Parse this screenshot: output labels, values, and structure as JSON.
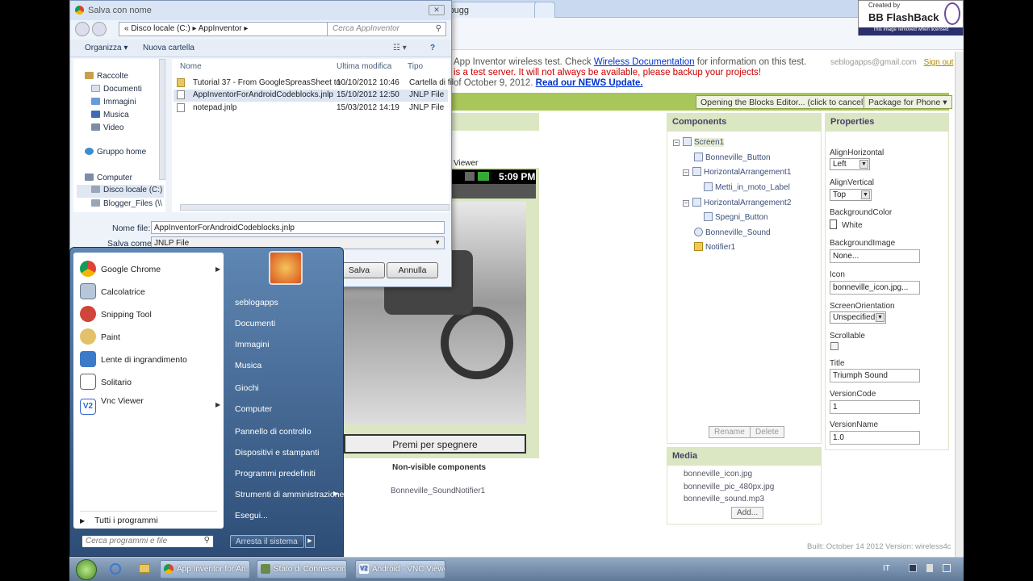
{
  "browser": {
    "tabs": [
      {
        "title": "App Inventor Debugg"
      },
      {
        "title": ""
      }
    ],
    "flashback": {
      "created_by": "Created by",
      "brand": "BB FlashBack",
      "notice": "This image removed when licensed"
    }
  },
  "appinventor": {
    "message_line1_pre": "App Inventor wireless test. Check ",
    "message_line1_link": "Wireless Documentation",
    "message_line1_post": " for information on this test.",
    "message_line2": "is a test server. It will not always be available, please backup your projects!",
    "message_line3_pre": "of October 9, 2012. ",
    "message_line3_link": "Read our NEWS Update.",
    "user_email": "seblogapps@gmail.com",
    "sign_out": "Sign out",
    "blocks_button": "Opening the Blocks Editor... (click to cancel)",
    "package_button": "Package for Phone ▾",
    "components_title": "Components",
    "properties_title": "Properties",
    "components": [
      {
        "label": "Screen1",
        "expand": "⊟"
      },
      {
        "label": "Bonneville_Button",
        "expand": ""
      },
      {
        "label": "HorizontalArrangement1",
        "expand": "⊟"
      },
      {
        "label": "Metti_in_moto_Label",
        "expand": ""
      },
      {
        "label": "HorizontalArrangement2",
        "expand": "⊟"
      },
      {
        "label": "Spegni_Button",
        "expand": ""
      },
      {
        "label": "Bonneville_Sound",
        "expand": ""
      },
      {
        "label": "Notifier1",
        "expand": ""
      }
    ],
    "rename": "Rename",
    "delete": "Delete",
    "media_title": "Media",
    "media": [
      "bonneville_icon.jpg",
      "bonneville_pic_480px.jpg",
      "bonneville_sound.mp3"
    ],
    "add_button": "Add...",
    "properties": {
      "align_horizontal_label": "AlignHorizontal",
      "align_horizontal": "Left",
      "align_vertical_label": "AlignVertical",
      "align_vertical": "Top",
      "background_color_label": "BackgroundColor",
      "background_color": "White",
      "background_image_label": "BackgroundImage",
      "background_image": "None...",
      "icon_label": "Icon",
      "icon": "bonneville_icon.jpg...",
      "orientation_label": "ScreenOrientation",
      "orientation": "Unspecified",
      "scrollable_label": "Scrollable",
      "title_label": "Title",
      "title": "Triumph Sound",
      "version_code_label": "VersionCode",
      "version_code": "1",
      "version_name_label": "VersionName",
      "version_name": "1.0"
    },
    "viewer_label": "Viewer",
    "phone_time": "5:09 PM",
    "phone_button": "Premi per spegnere",
    "nonvisible_title": "Non-visible components",
    "nonvisible": [
      "Bonneville_Sound",
      "Notifier1"
    ],
    "build": "Built: October 14 2012 Version: wireless4c"
  },
  "dialog": {
    "title": "Salva con nome",
    "path": "«  Disco locale (C:)  ▸  AppInventor  ▸",
    "search_placeholder": "Cerca AppInventor",
    "organize": "Organizza ▾",
    "new_folder": "Nuova cartella",
    "nav": [
      "Raccolte",
      "Documenti",
      "Immagini",
      "Musica",
      "Video",
      "Gruppo home",
      "Computer",
      "Disco locale (C:)",
      "Blogger_Files (\\\\"
    ],
    "columns": {
      "name": "Nome",
      "modified": "Ultima modifica",
      "type": "Tipo"
    },
    "files": [
      {
        "name": "Tutorial 37 - From GoogleSpreasSheet to ...",
        "modified": "10/10/2012 10:46",
        "type": "Cartella di fil"
      },
      {
        "name": "AppInventorForAndroidCodeblocks.jnlp",
        "modified": "15/10/2012 12:50",
        "type": "JNLP File"
      },
      {
        "name": "notepad.jnlp",
        "modified": "15/03/2012 14:19",
        "type": "JNLP File"
      }
    ],
    "filename_label": "Nome file:",
    "filename": "AppInventorForAndroidCodeblocks.jnlp",
    "savetype_label": "Salva come:",
    "savetype": "JNLP File",
    "save": "Salva",
    "cancel": "Annulla"
  },
  "startmenu": {
    "pinned": [
      "Google Chrome",
      "Calcolatrice",
      "Snipping Tool",
      "Paint",
      "Lente di ingrandimento",
      "Solitario",
      "Vnc Viewer"
    ],
    "all_programs": "Tutti i programmi",
    "search_placeholder": "Cerca programmi e file",
    "right": [
      "seblogapps",
      "Documenti",
      "Immagini",
      "Musica",
      "Giochi",
      "Computer",
      "Pannello di controllo",
      "Dispositivi e stampanti",
      "Programmi predefiniti",
      "Strumenti di amministrazione",
      "Esegui..."
    ],
    "shutdown": "Arresta il sistema"
  },
  "taskbar": {
    "items": [
      "App Inventor for An...",
      "Stato di Connessione...",
      "Android - VNC Viewer"
    ],
    "lang": "IT"
  }
}
